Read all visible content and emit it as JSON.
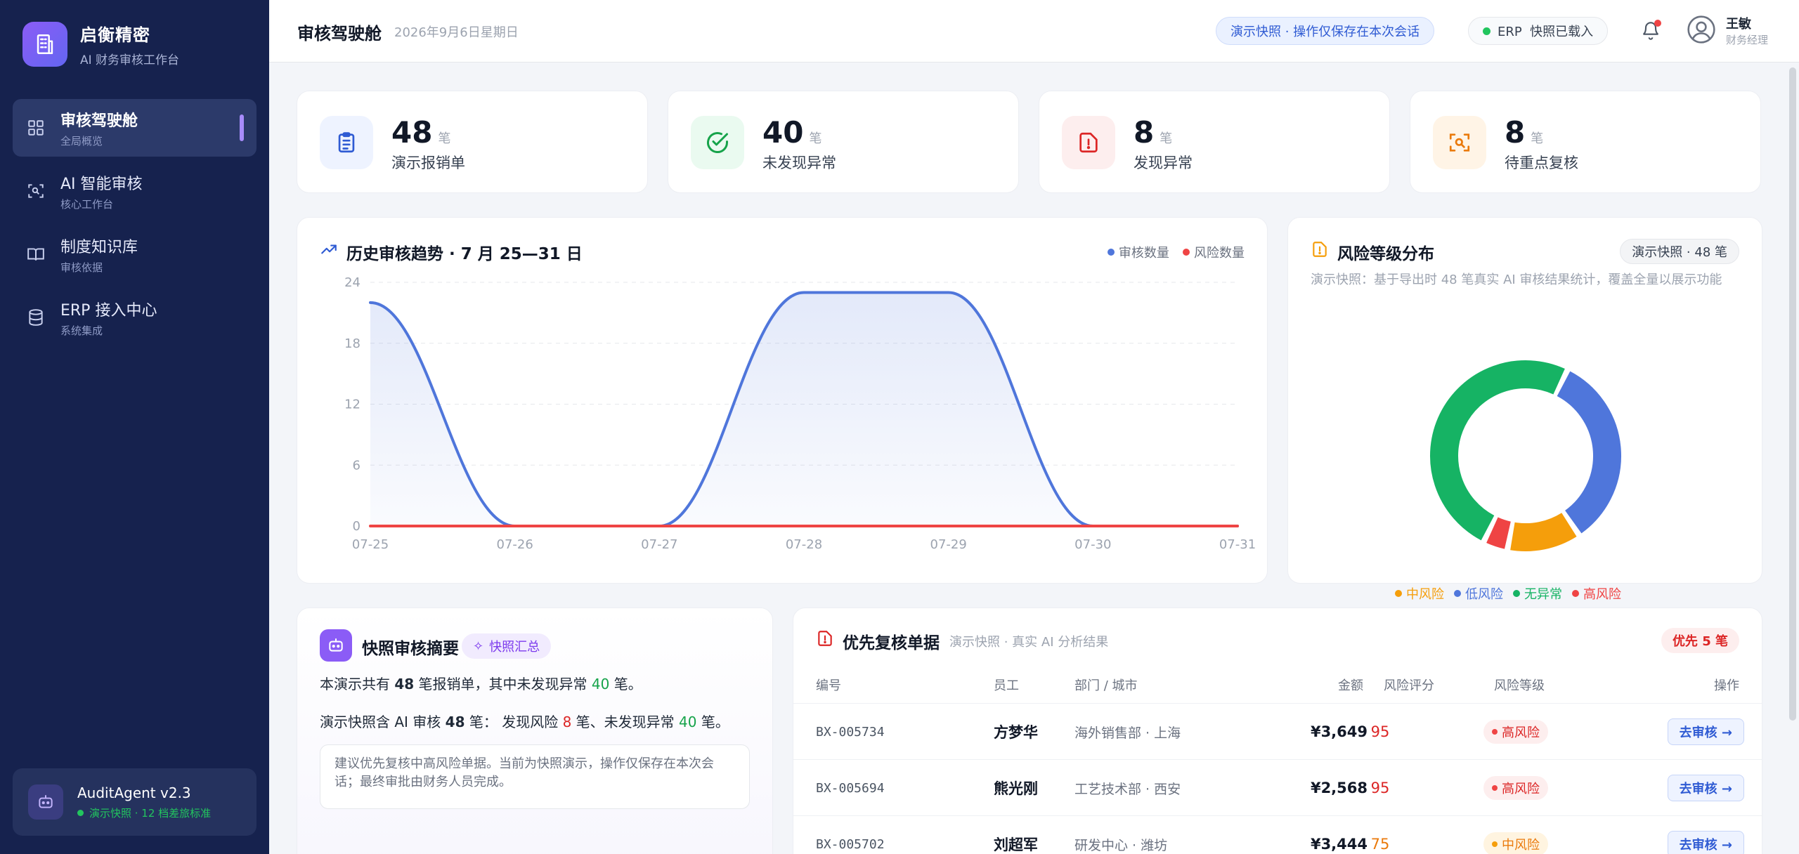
{
  "brand": {
    "name": "启衡精密",
    "subtitle": "AI 财务审核工作台"
  },
  "sidebar": {
    "items": [
      {
        "label": "审核驾驶舱",
        "sub": "全局概览"
      },
      {
        "label": "AI 智能审核",
        "sub": "核心工作台"
      },
      {
        "label": "制度知识库",
        "sub": "审核依据"
      },
      {
        "label": "ERP 接入中心",
        "sub": "系统集成"
      }
    ],
    "active_index": 0,
    "agent": {
      "name": "AuditAgent v2.3",
      "status": "演示快照 · 12 档差旅标准"
    }
  },
  "header": {
    "title": "审核驾驶舱",
    "date": "2026年9月6日星期日",
    "snapshot_pill": "演示快照 · 操作仅保存在本次会话",
    "erp_pill": "ERP  快照已载入",
    "user_name": "王敏",
    "user_role": "财务经理"
  },
  "stats": [
    {
      "value": "48",
      "unit": "笔",
      "label": "演示报销单",
      "icon": "clipboard-icon",
      "color": "#2f5bd3",
      "bg": "#eef3ff"
    },
    {
      "value": "40",
      "unit": "笔",
      "label": "未发现异常",
      "icon": "check-circle-icon",
      "color": "#16a34a",
      "bg": "#eafaf0"
    },
    {
      "value": "8",
      "unit": "笔",
      "label": "发现异常",
      "icon": "alert-file-icon",
      "color": "#dc2626",
      "bg": "#fdeeee"
    },
    {
      "value": "8",
      "unit": "笔",
      "label": "待重点复核",
      "icon": "scan-icon",
      "color": "#ea7a0c",
      "bg": "#fff4e6"
    }
  ],
  "trend": {
    "title": "历史审核趋势 · 7 月 25—31 日",
    "legend": [
      "审核数量",
      "风险数量"
    ],
    "colors": {
      "audit": "#4f76db",
      "risk": "#ef4444"
    }
  },
  "chart_data": {
    "type": "area",
    "x": [
      "07-25",
      "07-26",
      "07-27",
      "07-28",
      "07-29",
      "07-30",
      "07-31"
    ],
    "series": [
      {
        "name": "审核数量",
        "values": [
          22,
          0,
          0,
          23,
          23,
          0,
          0
        ]
      },
      {
        "name": "风险数量",
        "values": [
          0,
          0,
          0,
          0,
          0,
          0,
          0
        ]
      }
    ],
    "yticks": [
      0,
      6,
      12,
      18,
      24
    ],
    "ylim": [
      0,
      24
    ],
    "grid": true,
    "legend_position": "top-right"
  },
  "risk": {
    "title": "风险等级分布",
    "tag": "演示快照 · 48 笔",
    "desc": "演示快照：基于导出时 48 笔真实 AI 审核结果统计，覆盖全量以展示功能",
    "legend": [
      {
        "label": "中风险",
        "color": "#f59e0b"
      },
      {
        "label": "低风险",
        "color": "#4f76db"
      },
      {
        "label": "无异常",
        "color": "#16b364"
      },
      {
        "label": "高风险",
        "color": "#ef4444"
      }
    ],
    "donut": [
      {
        "label": "低风险",
        "value": 16,
        "color": "#4f76db"
      },
      {
        "label": "中风险",
        "value": 6,
        "color": "#f59e0b"
      },
      {
        "label": "高风险",
        "value": 2,
        "color": "#ef4444"
      },
      {
        "label": "无异常",
        "value": 24,
        "color": "#16b364"
      }
    ]
  },
  "summary": {
    "title": "快照审核摘要",
    "badge": "快照汇总",
    "line1": {
      "a": "本演示共有 ",
      "n1": "48",
      "b": " 笔报销单，其中未发现异常 ",
      "n2": "40",
      "c": " 笔。"
    },
    "line2": {
      "a": "演示快照含 AI 审核 ",
      "n1": "48",
      "b": " 笔： 发现风险 ",
      "n2": "8",
      "c": " 笔、未发现异常 ",
      "n3": "40",
      "d": " 笔。"
    },
    "note": "建议优先复核中高风险单据。当前为快照演示，操作仅保存在本次会话；最终审批由财务人员完成。"
  },
  "priority": {
    "title": "优先复核单据",
    "subtitle": "演示快照 · 真实 AI 分析结果",
    "badge": "优先 5 笔",
    "headers": {
      "id": "编号",
      "emp": "员工",
      "dept": "部门 / 城市",
      "amt": "金额",
      "score": "风险评分",
      "level": "风险等级",
      "op": "操作"
    },
    "rows": [
      {
        "id": "BX-005734",
        "emp": "方梦华",
        "dept": "海外销售部 · 上海",
        "amt": "¥3,649",
        "score": "95",
        "level": "高风险",
        "op": "去审核 →"
      },
      {
        "id": "BX-005694",
        "emp": "熊光刚",
        "dept": "工艺技术部 · 西安",
        "amt": "¥2,568",
        "score": "95",
        "level": "高风险",
        "op": "去审核 →"
      },
      {
        "id": "BX-005702",
        "emp": "刘超军",
        "dept": "研发中心 · 潍坊",
        "amt": "¥3,444",
        "score": "75",
        "level": "中风险",
        "op": "去审核 →"
      }
    ]
  }
}
